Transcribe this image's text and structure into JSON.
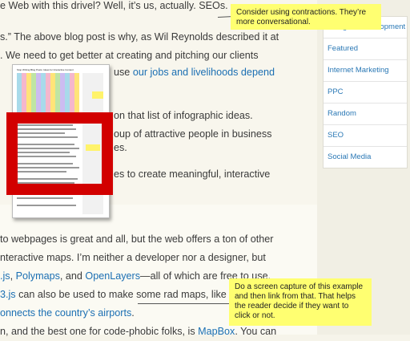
{
  "article": {
    "line1": "e Web with this drivel? Well, it’s us, actually. SEOs.",
    "line2": "s.” The above blog post is why, as Wil Reynolds described it at",
    "line3": ". We need to get better at creating and pitching our clients",
    "line4_plain": "use ",
    "line4_link": "our jobs and livelihoods depend",
    "line5": "on that list of infographic ideas.",
    "line6": "oup of attractive people in business",
    "line7": "es.",
    "line8": "es to create meaningful, interactive",
    "line9": "to webpages is great and all, but the web offers a ton of other",
    "line10": "nteractive maps. I’m neither a developer nor a designer, but",
    "line11_link1": ".js",
    "line11_sep1": ", ",
    "line11_link2": "Polymaps",
    "line11_sep2": ", and ",
    "line11_link3": "OpenLayers",
    "line11_rest": "—all of which are free to use.",
    "line12_link": "3.js",
    "line12_rest": " can also be used to make some rad maps, like",
    "line13_link": "onnects the country’s airports",
    "line13_rest": ".",
    "line14_plain": "n, and the best one for code-phobic folks, is ",
    "line14_link": "MapBox",
    "line14_rest": ". You can"
  },
  "thumbnail": {
    "title": "Stop Writing Blog Posts: Ideas for Interactive Content"
  },
  "sidebar": {
    "categories": [
      "Design & Development",
      "Featured",
      "Internet Marketing",
      "PPC",
      "Random",
      "SEO",
      "Social Media"
    ]
  },
  "comments": {
    "note1": "Consider using contractions. They’re more conversational.",
    "note2": "Do a screen capture of this example and then link from that. That helps the reader decide if they want to click or not."
  },
  "colors": {
    "link": "#1b6fb3",
    "highlight_frame": "#d20000",
    "comment_note": "#ffff71"
  }
}
